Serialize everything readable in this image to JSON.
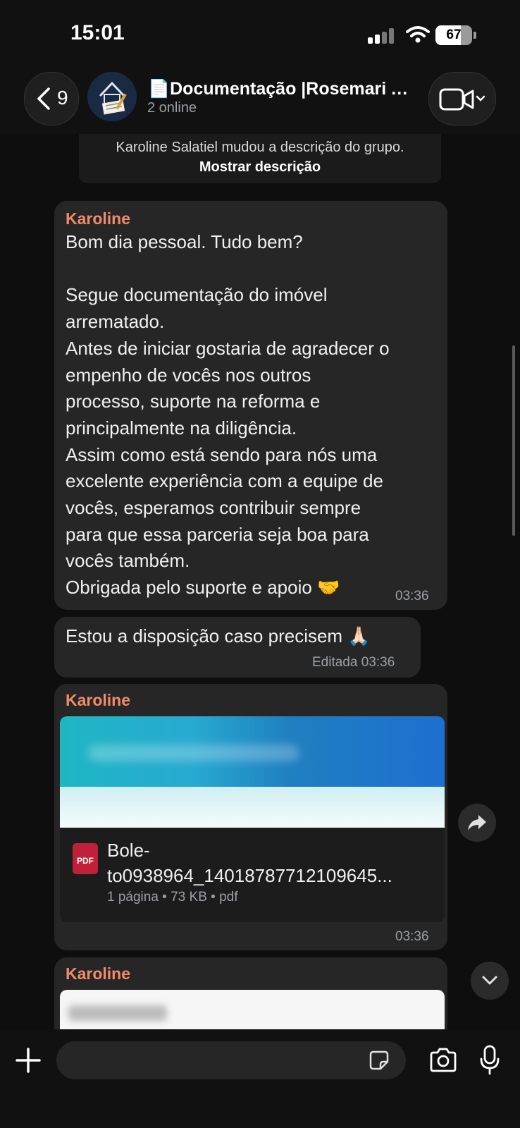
{
  "status_bar": {
    "time": "15:01",
    "battery": "67"
  },
  "header": {
    "back_count": "9",
    "title": "📄Documentação |Rosemari A...",
    "subtitle": "2 online"
  },
  "system_message": {
    "text": "Karoline Salatiel mudou a descrição do grupo.",
    "link": "Mostrar descrição"
  },
  "messages": [
    {
      "sender": "Karoline",
      "text": "Bom dia pessoal. Tudo bem?\n\nSegue documentação do imóvel\narrematado.\nAntes de iniciar gostaria de agradecer o\nempenho de vocês nos outros\nprocesso, suporte na reforma e\nprincipalmente na diligência.\nAssim como está sendo para nós uma\nexcelente experiência com a equipe de\nvocês, esperamos contribuir sempre\npara que essa parceria seja boa para\nvocês também.\nObrigada pelo suporte e apoio 🤝",
      "time": "03:36"
    },
    {
      "text": "Estou a disposição caso precisem 🙏🏻",
      "time": "Editada 03:36"
    },
    {
      "sender": "Karoline",
      "file_type_label": "PDF",
      "file_name_line1": "Bole-",
      "file_name_line2": "to0938964_14018787712109645...",
      "file_meta": "1 página • 73 KB • pdf",
      "time": "03:36"
    },
    {
      "sender": "Karoline"
    }
  ],
  "icons": {
    "back": "chevron-left-icon",
    "video": "video-camera-icon",
    "forward": "forward-icon",
    "scroll_down": "chevron-down-icon",
    "plus": "plus-icon",
    "sticker": "sticker-icon",
    "camera": "camera-icon",
    "mic": "microphone-icon"
  },
  "colors": {
    "sender": "#f28b6b",
    "bubble": "#262626",
    "background": "#0e0e0e"
  }
}
